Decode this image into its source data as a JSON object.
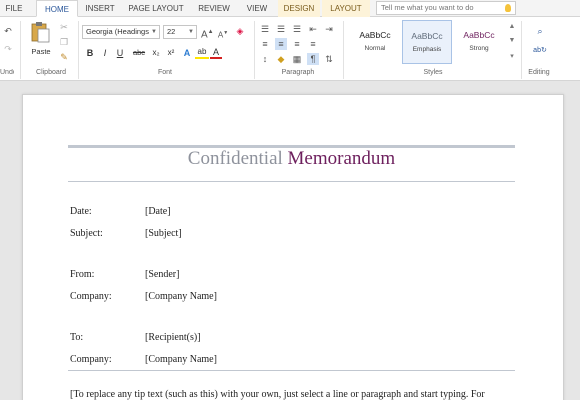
{
  "tabs": [
    "FILE",
    "HOME",
    "INSERT",
    "PAGE LAYOUT",
    "REVIEW",
    "VIEW",
    "DESIGN",
    "LAYOUT"
  ],
  "tell_me": "Tell me what you want to do",
  "ribbon": {
    "clipboard": {
      "paste": "Paste",
      "label": "Clipboard"
    },
    "undo_label": "Undo",
    "font": {
      "name": "Georgia (Headings",
      "size": "22",
      "grow": "A",
      "shrink": "A",
      "bold": "B",
      "italic": "I",
      "underline": "U",
      "strike": "abc",
      "subscript": "x₂",
      "superscript": "x²",
      "text_effects": "A",
      "highlight": "ab",
      "font_color": "A",
      "label": "Font"
    },
    "paragraph_label": "Paragraph",
    "styles": {
      "items": [
        {
          "sample": "AaBbCc",
          "name": "Normal"
        },
        {
          "sample": "AaBbCc",
          "name": "Emphasis"
        },
        {
          "sample": "AaBbCc",
          "name": "Strong"
        }
      ],
      "label": "Styles"
    },
    "editing_label": "Editing"
  },
  "document": {
    "title_part1": "Confidential",
    "title_part2": "Memorandum",
    "fields": [
      {
        "label": "Date:",
        "value": "[Date]"
      },
      {
        "label": "Subject:",
        "value": "[Subject]"
      },
      {
        "label": "From:",
        "value": "[Sender]"
      },
      {
        "label": "Company:",
        "value": "[Company Name]"
      },
      {
        "label": "To:",
        "value": "[Recipient(s)]"
      },
      {
        "label": "Company:",
        "value": "[Company Name]"
      }
    ],
    "tip": "[To replace any tip text (such as this) with your own, just select a line or paragraph and start typing. For"
  },
  "colors": {
    "accent": "#2b579a",
    "title_gray": "#8e929c",
    "title_purple": "#6d1f5d",
    "rule": "#c1c7d0"
  }
}
